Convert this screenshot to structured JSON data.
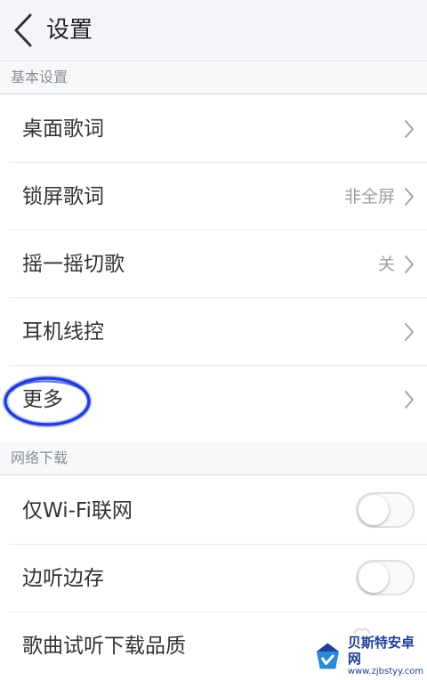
{
  "header": {
    "title": "设置",
    "back_icon": "chevron-left-icon"
  },
  "sections": {
    "basic": {
      "title": "基本设置"
    },
    "network": {
      "title": "网络下载"
    }
  },
  "rows": {
    "desktop_lyrics": {
      "label": "桌面歌词",
      "icon": "chevron-right-icon"
    },
    "lockscreen_lyrics": {
      "label": "锁屏歌词",
      "value": "非全屏",
      "icon": "chevron-right-icon"
    },
    "shake_switch": {
      "label": "摇一摇切歌",
      "value": "关",
      "icon": "chevron-right-icon"
    },
    "earphone_control": {
      "label": "耳机线控",
      "icon": "chevron-right-icon"
    },
    "more": {
      "label": "更多",
      "icon": "chevron-right-icon"
    },
    "wifi_only": {
      "label": "仅Wi-Fi联网",
      "toggle_on": false
    },
    "listen_save": {
      "label": "边听边存",
      "toggle_on": false
    },
    "quality": {
      "label": "歌曲试听下载品质"
    }
  },
  "annotation": {
    "color": "#1f3fd6",
    "target": "more"
  },
  "watermark": {
    "name": "贝斯特安卓网",
    "url": "www.zjbstyy.com"
  },
  "colors": {
    "header_bg": "#f3f5f9",
    "section_bg": "#f7f8fa",
    "section_line": "#c9dde9",
    "secondary_text": "#9ba0a6"
  }
}
